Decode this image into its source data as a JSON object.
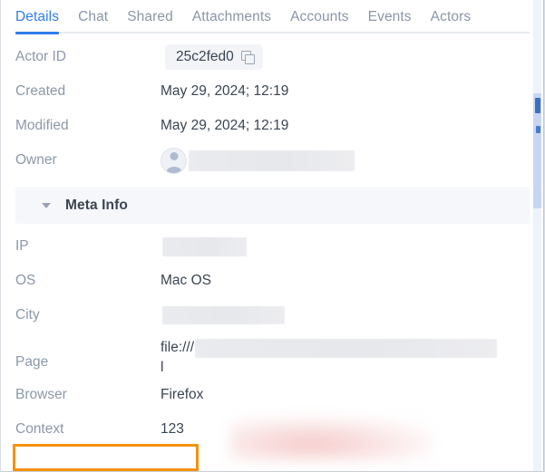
{
  "tabs": [
    {
      "label": "Details",
      "active": true
    },
    {
      "label": "Chat",
      "active": false
    },
    {
      "label": "Shared",
      "active": false
    },
    {
      "label": "Attachments",
      "active": false
    },
    {
      "label": "Accounts",
      "active": false
    },
    {
      "label": "Events",
      "active": false
    },
    {
      "label": "Actors",
      "active": false
    }
  ],
  "details": {
    "actor_id": {
      "label": "Actor ID",
      "value": "25c2fed0",
      "copy_icon": "copy-icon"
    },
    "created": {
      "label": "Created",
      "value": "May 29, 2024; 12:19"
    },
    "modified": {
      "label": "Modified",
      "value": "May 29, 2024; 12:19"
    },
    "owner": {
      "label": "Owner",
      "value": "",
      "avatar_icon": "avatar-person-icon",
      "redacted": true
    }
  },
  "section": {
    "title": "Meta Info",
    "caret_icon": "caret-down-icon",
    "expanded": true
  },
  "meta": {
    "ip": {
      "label": "IP",
      "value": "",
      "redacted": true
    },
    "os": {
      "label": "OS",
      "value": "Mac OS"
    },
    "city": {
      "label": "City",
      "value": "",
      "redacted": true
    },
    "page": {
      "label": "Page",
      "value_prefix": "file:///",
      "value_suffix": "l",
      "redacted": true
    },
    "browser": {
      "label": "Browser",
      "value": "Firefox"
    },
    "context": {
      "label": "Context",
      "value": "123",
      "highlighted": true
    }
  },
  "colors": {
    "accent_blue": "#2f7def",
    "label_gray": "#8c98a9",
    "value_dark": "#3b4453",
    "section_band": "#f5f7fa",
    "chip_bg": "#f2f4f7",
    "highlight_orange": "#f5920b",
    "scrollbar_thumb": "#c6d6f4"
  }
}
